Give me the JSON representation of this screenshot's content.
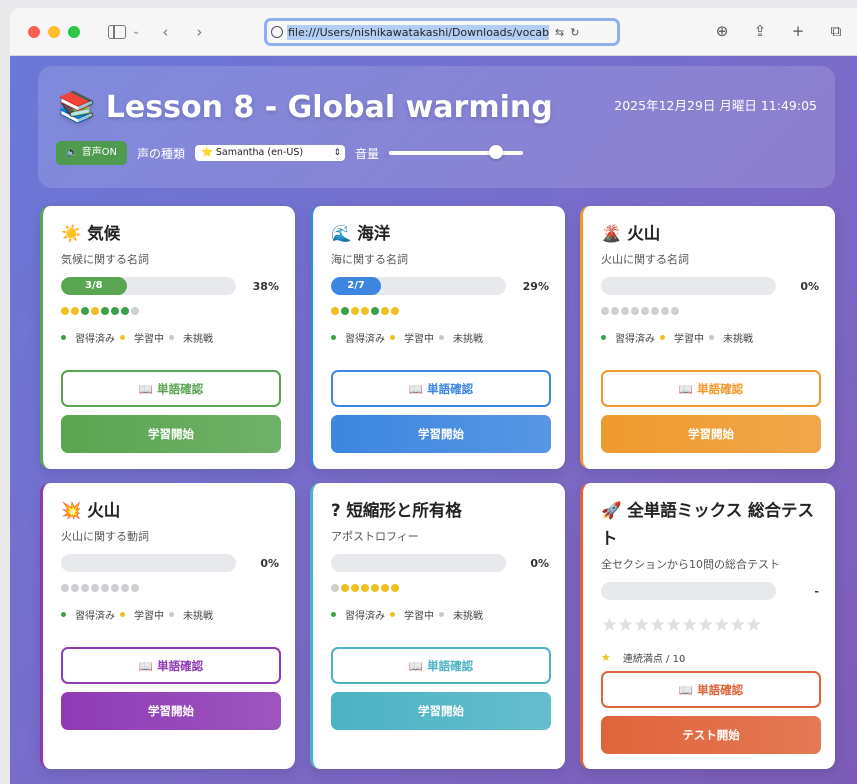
{
  "browser": {
    "url": "file:///Users/nishikawatakashi/Downloads/vocab_ap",
    "back_icon": "chevron-left-icon",
    "forward_icon": "chevron-right-icon"
  },
  "header": {
    "title": "📚 Lesson 8 - Global warming",
    "datetime": "2025年12月29日 月曜日 11:49:05",
    "voice_toggle": "🔈 音声ON",
    "voice_type_label": "声の種類",
    "voice_select_value": "⭐ Samantha (en-US)",
    "volume_label": "音量",
    "volume_value": 0.8
  },
  "legend": {
    "mastered": "習得済み",
    "learning": "学習中",
    "untried": "未挑戦"
  },
  "cards": [
    {
      "title": "☀️ 気候",
      "subtitle": "気候に関する名詞",
      "progress_label": "3/8",
      "progress_fraction": 0.375,
      "percent": "38%",
      "dots": [
        "y",
        "y",
        "g",
        "y",
        "g",
        "g",
        "g",
        "s"
      ],
      "check_label": "📖 単語確認",
      "start_label": "学習開始",
      "accent": "#5aa551"
    },
    {
      "title": "🌊 海洋",
      "subtitle": "海に関する名詞",
      "progress_label": "2/7",
      "progress_fraction": 0.286,
      "percent": "29%",
      "dots": [
        "y",
        "g",
        "y",
        "y",
        "g",
        "y",
        "y"
      ],
      "check_label": "📖 単語確認",
      "start_label": "学習開始",
      "accent": "#3d86e0"
    },
    {
      "title": "🌋 火山",
      "subtitle": "火山に関する名詞",
      "progress_label": "",
      "progress_fraction": 0,
      "percent": "0%",
      "dots": [
        "s",
        "s",
        "s",
        "s",
        "s",
        "s",
        "s",
        "s"
      ],
      "check_label": "📖 単語確認",
      "start_label": "学習開始",
      "accent": "#ef9a2e"
    },
    {
      "title": "💥 火山",
      "subtitle": "火山に関する動詞",
      "progress_label": "",
      "progress_fraction": 0,
      "percent": "0%",
      "dots": [
        "s",
        "s",
        "s",
        "s",
        "s",
        "s",
        "s",
        "s"
      ],
      "check_label": "📖 単語確認",
      "start_label": "学習開始",
      "accent": "#8e3bb5"
    },
    {
      "title": "? 短縮形と所有格",
      "subtitle": "アポストロフィー",
      "progress_label": "",
      "progress_fraction": 0,
      "percent": "0%",
      "dots": [
        "s",
        "y",
        "y",
        "y",
        "y",
        "y",
        "y"
      ],
      "check_label": "📖 単語確認",
      "start_label": "学習開始",
      "accent": "#4cb3c4"
    },
    {
      "title": "🚀 全単語ミックス 総合テスト",
      "subtitle": "全セクションから10問の総合テスト",
      "percent": "-",
      "stars": "★★★★★★★★★★",
      "streak_label": "連続満点 / 10",
      "check_label": "📖 単語確認",
      "start_label": "テスト開始",
      "accent": "#e0643a"
    }
  ],
  "colors": {
    "page_gradient_start": "#6a78d8",
    "page_gradient_end": "#7c5cb8"
  }
}
